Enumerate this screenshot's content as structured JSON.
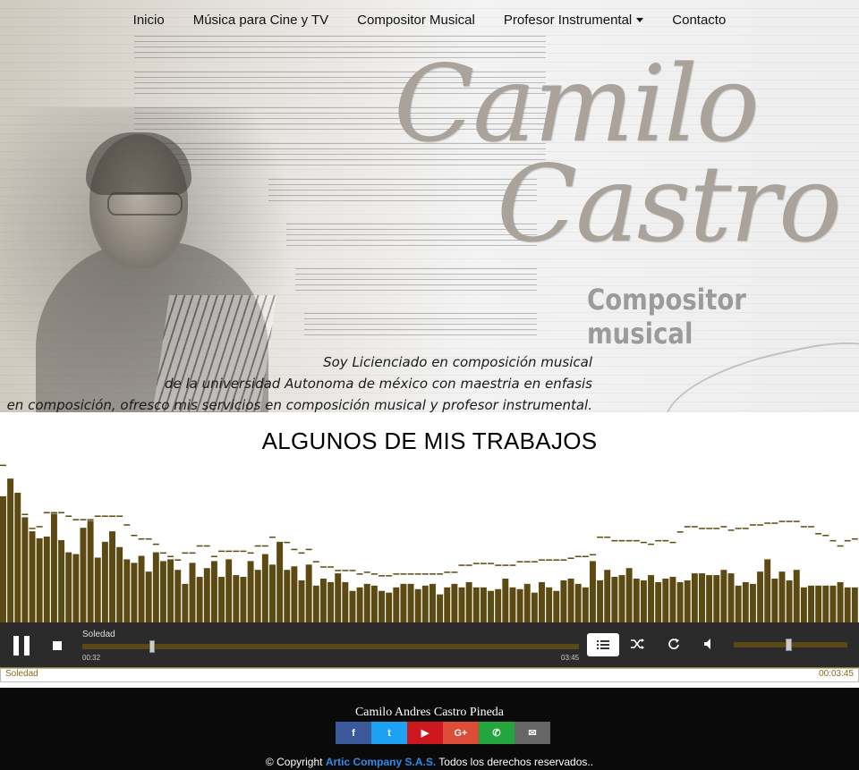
{
  "nav": {
    "items": [
      {
        "label": "Inicio"
      },
      {
        "label": "Música para Cine y TV"
      },
      {
        "label": "Compositor Musical"
      },
      {
        "label": "Profesor Instrumental",
        "dropdown": true
      },
      {
        "label": "Contacto"
      }
    ]
  },
  "hero": {
    "logo_line1": "Camilo",
    "logo_line2": "Castro",
    "subtitle": "Compositor musical",
    "intro_lines": [
      "Soy Licienciado en composición musical",
      "de la universidad Autonoma de méxico con maestria en enfasis",
      "en composición, ofresco mis servicios en composición musical y profesor instrumental."
    ]
  },
  "section": {
    "title": "ALGUNOS DE MIS TRABAJOS"
  },
  "visualizer": {
    "bar_color": "#5c4a12",
    "cap_color": "#5c4a12",
    "levels": [
      0.72,
      0.82,
      0.74,
      0.6,
      0.52,
      0.48,
      0.49,
      0.62,
      0.47,
      0.4,
      0.39,
      0.54,
      0.58,
      0.37,
      0.46,
      0.52,
      0.43,
      0.36,
      0.34,
      0.38,
      0.29,
      0.4,
      0.35,
      0.36,
      0.3,
      0.22,
      0.34,
      0.26,
      0.31,
      0.35,
      0.26,
      0.36,
      0.27,
      0.26,
      0.35,
      0.3,
      0.39,
      0.33,
      0.46,
      0.3,
      0.32,
      0.24,
      0.33,
      0.21,
      0.25,
      0.23,
      0.28,
      0.23,
      0.18,
      0.2,
      0.22,
      0.21,
      0.18,
      0.17,
      0.2,
      0.22,
      0.22,
      0.19,
      0.21,
      0.22,
      0.16,
      0.2,
      0.22,
      0.2,
      0.23,
      0.2,
      0.2,
      0.18,
      0.19,
      0.25,
      0.2,
      0.19,
      0.22,
      0.17,
      0.23,
      0.2,
      0.18,
      0.24,
      0.25,
      0.22,
      0.2,
      0.35,
      0.24,
      0.3,
      0.26,
      0.27,
      0.31,
      0.25,
      0.24,
      0.27,
      0.23,
      0.25,
      0.26,
      0.23,
      0.24,
      0.28,
      0.28,
      0.27,
      0.27,
      0.3,
      0.28,
      0.21,
      0.23,
      0.22,
      0.29,
      0.36,
      0.25,
      0.29,
      0.24,
      0.3,
      0.2,
      0.21,
      0.21,
      0.21,
      0.21,
      0.23,
      0.2,
      0.2
    ],
    "caps": [
      0.9,
      0.82,
      0.64,
      0.62,
      0.54,
      0.55,
      0.63,
      0.63,
      0.63,
      0.61,
      0.59,
      0.59,
      0.59,
      0.61,
      0.61,
      0.61,
      0.61,
      0.56,
      0.5,
      0.48,
      0.48,
      0.45,
      0.4,
      0.38,
      0.36,
      0.4,
      0.4,
      0.44,
      0.44,
      0.38,
      0.41,
      0.41,
      0.41,
      0.41,
      0.4,
      0.44,
      0.44,
      0.49,
      0.44,
      0.46,
      0.42,
      0.4,
      0.42,
      0.35,
      0.32,
      0.32,
      0.3,
      0.3,
      0.3,
      0.28,
      0.29,
      0.28,
      0.27,
      0.27,
      0.28,
      0.28,
      0.28,
      0.28,
      0.28,
      0.28,
      0.28,
      0.29,
      0.29,
      0.33,
      0.33,
      0.34,
      0.34,
      0.34,
      0.33,
      0.33,
      0.33,
      0.35,
      0.35,
      0.35,
      0.36,
      0.36,
      0.36,
      0.36,
      0.37,
      0.38,
      0.38,
      0.39,
      0.49,
      0.49,
      0.47,
      0.47,
      0.47,
      0.47,
      0.46,
      0.45,
      0.47,
      0.47,
      0.46,
      0.52,
      0.55,
      0.55,
      0.54,
      0.54,
      0.54,
      0.55,
      0.53,
      0.54,
      0.54,
      0.56,
      0.56,
      0.57,
      0.57,
      0.58,
      0.58,
      0.58,
      0.55,
      0.55,
      0.51,
      0.5,
      0.47,
      0.44,
      0.47,
      0.48
    ]
  },
  "player": {
    "track_title": "Soledad",
    "current_time": "00:32",
    "total_time": "03:45",
    "progress": 0.14,
    "volume": 0.48,
    "accent": "#5a4817"
  },
  "playlist": {
    "items": [
      {
        "title": "Soledad",
        "duration": "00:03:45"
      }
    ]
  },
  "footer": {
    "name": "Camilo Andres Castro Pineda",
    "socials": [
      {
        "icon": "facebook-icon",
        "glyph": "f",
        "color": "#3b5998"
      },
      {
        "icon": "twitter-icon",
        "glyph": "t",
        "color": "#1da1f2"
      },
      {
        "icon": "youtube-icon",
        "glyph": "▶",
        "color": "#cc181e"
      },
      {
        "icon": "google-plus-icon",
        "glyph": "G+",
        "color": "#dd4b39"
      },
      {
        "icon": "whatsapp-icon",
        "glyph": "✆",
        "color": "#22a53c"
      },
      {
        "icon": "email-icon",
        "glyph": "✉",
        "color": "#666666"
      }
    ],
    "copyright_prefix": "© Copyright",
    "company": "Artic Company S.A.S.",
    "copyright_suffix": "Todos los derechos reservados.."
  }
}
